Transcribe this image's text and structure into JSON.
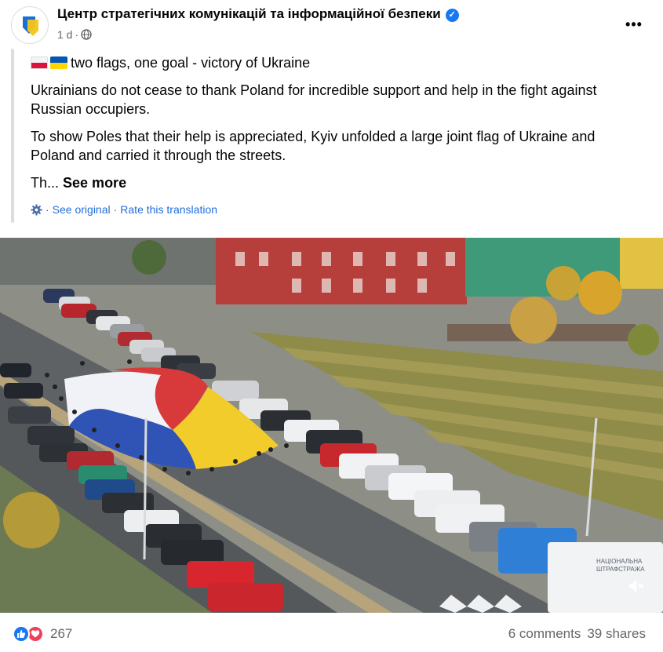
{
  "post": {
    "page_name": "Центр стратегічних комунікацій та інформаційної безпеки",
    "time": "1 d",
    "separator": "·",
    "more_glyph": "•••",
    "paragraphs": [
      "two flags, one goal - victory of Ukraine",
      "Ukrainians do not cease to thank Poland for incredible support and help in the fight against Russian occupiers.",
      "To show Poles that their help is appreciated, Kyiv unfolded a large joint flag of Ukraine and Poland and carried it through the streets."
    ],
    "truncated_text": "Th...",
    "see_more": "See more",
    "see_original": "See original",
    "rate_translation": "Rate this translation",
    "dot": "·"
  },
  "image": {
    "watermark_lines": [
      "НАЦІОНАЛЬНА",
      "ШТРАФСТРАЖА"
    ]
  },
  "footer": {
    "reaction_count": "267",
    "comments": "6 comments",
    "shares": "39 shares"
  },
  "colors": {
    "accent": "#1877f2",
    "love": "#f33e58",
    "muted": "#65676b",
    "link": "#216fdb"
  },
  "icons": {
    "verified": "verified-badge-icon",
    "globe": "globe-icon",
    "gear": "gear-icon",
    "more": "more-options-icon",
    "like": "like-reaction-icon",
    "love": "love-reaction-icon",
    "mute": "mute-icon"
  }
}
